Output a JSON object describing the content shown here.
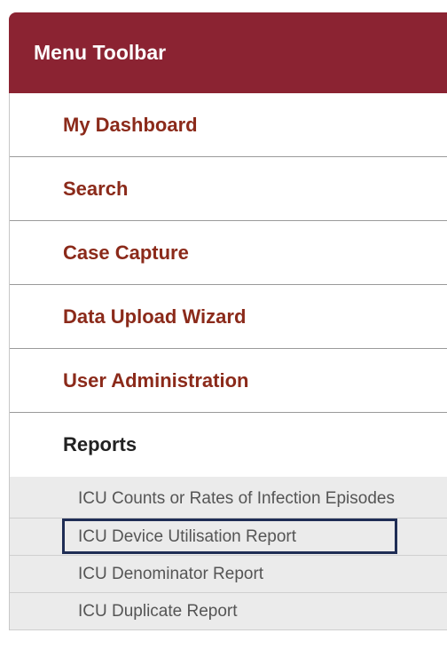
{
  "header": {
    "title": "Menu Toolbar"
  },
  "menu": {
    "items": [
      {
        "label": "My Dashboard"
      },
      {
        "label": "Search"
      },
      {
        "label": "Case Capture"
      },
      {
        "label": "Data Upload Wizard"
      },
      {
        "label": "User Administration"
      },
      {
        "label": "Reports"
      }
    ]
  },
  "reports_submenu": {
    "items": [
      {
        "label": "ICU Counts or Rates of Infection Episodes"
      },
      {
        "label": "ICU Device Utilisation Report",
        "highlighted": true
      },
      {
        "label": "ICU Denominator Report"
      },
      {
        "label": "ICU Duplicate Report"
      }
    ]
  },
  "colors": {
    "header_bg": "#8b2332",
    "menu_text": "#8b2a1a",
    "highlight_border": "#1f2d55",
    "submenu_bg": "#ebebeb"
  }
}
